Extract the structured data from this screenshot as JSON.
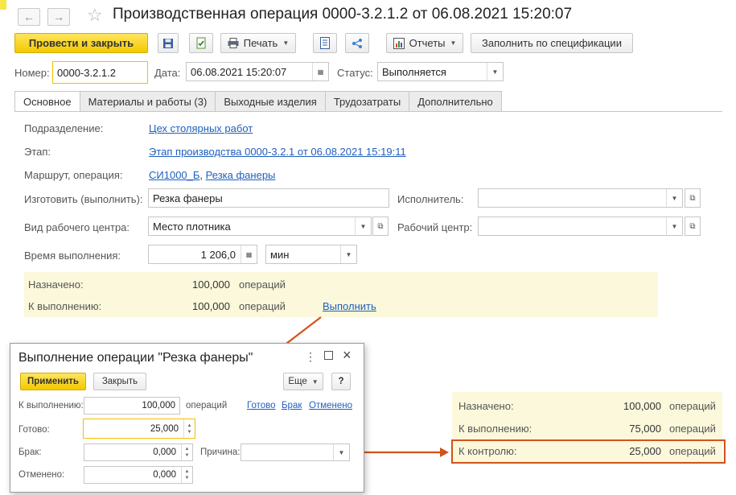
{
  "header": {
    "title": "Производственная операция 0000-3.2.1.2 от 06.08.2021 15:20:07",
    "nav_back_icon": "arrow-left-icon",
    "nav_forward_icon": "arrow-right-icon",
    "favorite_icon": "star-icon"
  },
  "toolbar": {
    "post_close_label": "Провести и закрыть",
    "print_label": "Печать",
    "reports_label": "Отчеты",
    "fill_spec_label": "Заполнить по спецификации"
  },
  "doc": {
    "number_label": "Номер:",
    "number_value": "0000-3.2.1.2",
    "date_label": "Дата:",
    "date_value": "06.08.2021 15:20:07",
    "status_label": "Статус:",
    "status_value": "Выполняется"
  },
  "tabs": [
    {
      "label": "Основное"
    },
    {
      "label": "Материалы и работы (3)"
    },
    {
      "label": "Выходные изделия"
    },
    {
      "label": "Трудозатраты"
    },
    {
      "label": "Дополнительно"
    }
  ],
  "main": {
    "division_label": "Подразделение:",
    "division_value": "Цех столярных работ",
    "stage_label": "Этап:",
    "stage_value": "Этап производства 0000-3.2.1 от 06.08.2021 15:19:11",
    "route_label": "Маршрут, операция:",
    "route_value": "СИ1000_Б",
    "route_sep": ",",
    "operation_value": "Резка фанеры",
    "make_label": "Изготовить (выполнить):",
    "make_value": "Резка фанеры",
    "executor_label": "Исполнитель:",
    "executor_value": "",
    "wc_type_label": "Вид рабочего центра:",
    "wc_type_value": "Место плотника",
    "wc_label": "Рабочий центр:",
    "wc_value": "",
    "time_label": "Время выполнения:",
    "time_value": "1 206,0",
    "time_unit": "мин"
  },
  "info": {
    "assigned_label": "Назначено:",
    "assigned_value": "100,000",
    "assigned_unit": "операций",
    "todo_label": "К выполнению:",
    "todo_value": "100,000",
    "todo_unit": "операций",
    "execute_link": "Выполнить"
  },
  "dialog": {
    "title": "Выполнение операции \"Резка фанеры\"",
    "menu_icon": "more-vertical-icon",
    "maximize_icon": "maximize-icon",
    "close_icon": "close-icon",
    "apply_label": "Применить",
    "close_label": "Закрыть",
    "more_label": "Еще",
    "help_label": "?",
    "todo_label": "К выполнению:",
    "todo_value": "100,000",
    "todo_unit": "операций",
    "link_done": "Готово",
    "link_defect": "Брак",
    "link_cancelled": "Отменено",
    "done_label": "Готово:",
    "done_value": "25,000",
    "defect_label": "Брак:",
    "defect_value": "0,000",
    "reason_label": "Причина:",
    "reason_value": "",
    "cancelled_label": "Отменено:",
    "cancelled_value": "0,000"
  },
  "summary": {
    "assigned_label": "Назначено:",
    "assigned_value": "100,000",
    "assigned_unit": "операций",
    "todo_label": "К выполнению:",
    "todo_value": "75,000",
    "todo_unit": "операций",
    "control_label": "К контролю:",
    "control_value": "25,000",
    "control_unit": "операций"
  },
  "colors": {
    "accent_yellow": "#f3c900",
    "highlight_frame": "#d2531b",
    "link": "#1f5fbf",
    "info_bg": "#fbf8db"
  }
}
